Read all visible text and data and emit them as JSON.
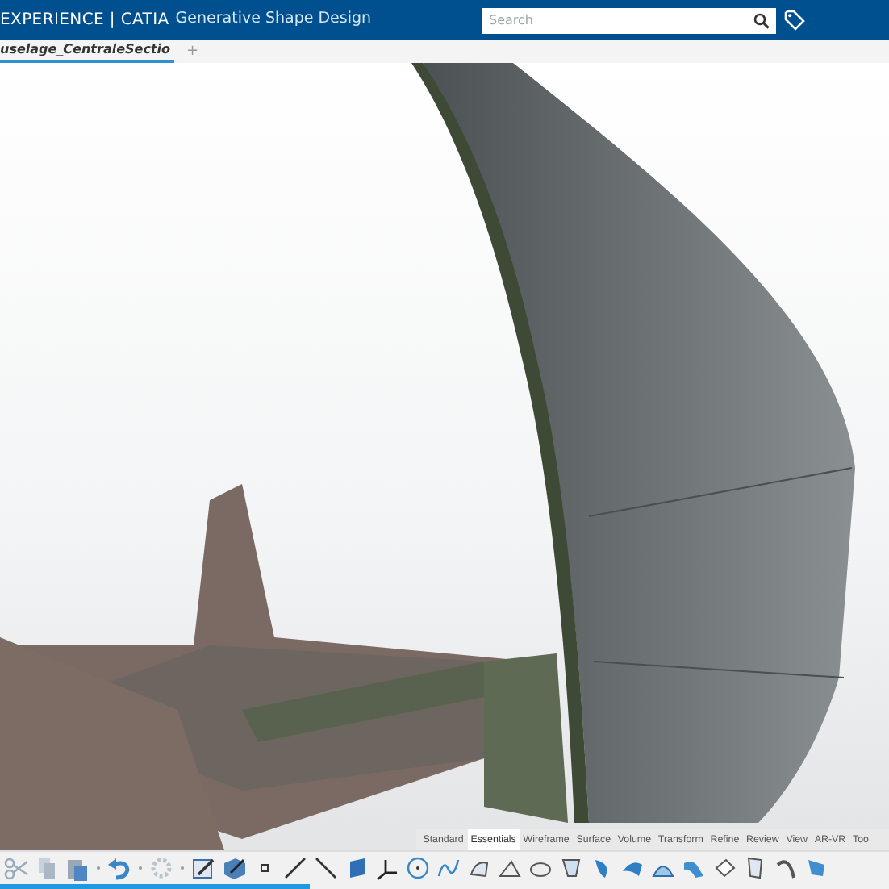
{
  "window": {
    "app_name": "EXPERIENCE | CATIA",
    "module": "Generative Shape Design"
  },
  "search": {
    "placeholder": "Search"
  },
  "document_tabs": [
    {
      "label": "uselage_CentraleSectio",
      "selected": true
    }
  ],
  "add_tab": "+",
  "section_tabs": [
    {
      "label": "Standard",
      "selected": false
    },
    {
      "label": "Essentials",
      "selected": true
    },
    {
      "label": "Wireframe",
      "selected": false
    },
    {
      "label": "Surface",
      "selected": false
    },
    {
      "label": "Volume",
      "selected": false
    },
    {
      "label": "Transform",
      "selected": false
    },
    {
      "label": "Refine",
      "selected": false
    },
    {
      "label": "Review",
      "selected": false
    },
    {
      "label": "View",
      "selected": false
    },
    {
      "label": "AR-VR",
      "selected": false
    },
    {
      "label": "Too",
      "selected": false
    }
  ]
}
